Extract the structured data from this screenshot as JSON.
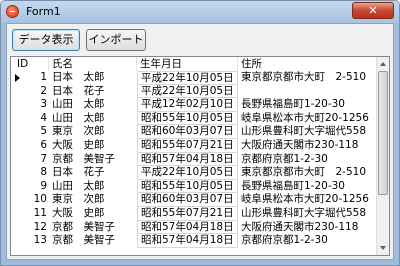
{
  "window": {
    "title": "Form1",
    "close_label": "✕"
  },
  "toolbar": {
    "show_data_label": "データ表示",
    "import_label": "インポート"
  },
  "grid": {
    "columns": [
      "ID",
      "氏名",
      "生年月日",
      "住所"
    ],
    "rows": [
      {
        "id": "1",
        "name": "日本　太郎",
        "dob": "平成22年10月05日",
        "address": "東京都京都市大町　2-510"
      },
      {
        "id": "2",
        "name": "日本　花子",
        "dob": "平成22年10月05日",
        "address": ""
      },
      {
        "id": "3",
        "name": "山田　太郎",
        "dob": "平成12年02月10日",
        "address": "長野県福島町1-20-30"
      },
      {
        "id": "4",
        "name": "山田　太郎",
        "dob": "昭和55年10月05日",
        "address": "岐阜県松本市大町20-1256"
      },
      {
        "id": "5",
        "name": "東京　次郎",
        "dob": "昭和60年03月07日",
        "address": "山形県豊科町大字堀代558"
      },
      {
        "id": "6",
        "name": "大阪　史郎",
        "dob": "昭和55年07月21日",
        "address": "大阪府通天閣市230-118"
      },
      {
        "id": "7",
        "name": "京都　美智子",
        "dob": "昭和57年04月18日",
        "address": "京都府京都1-2-30"
      },
      {
        "id": "8",
        "name": "日本　花子",
        "dob": "平成22年10月05日",
        "address": "東京都京都市大町　2-510"
      },
      {
        "id": "9",
        "name": "山田　太郎",
        "dob": "昭和55年10月05日",
        "address": "長野県福島町1-20-30"
      },
      {
        "id": "10",
        "name": "東京　次郎",
        "dob": "昭和60年03月07日",
        "address": "岐阜県松本市大町20-1256"
      },
      {
        "id": "11",
        "name": "大阪　史郎",
        "dob": "昭和55年07月21日",
        "address": "山形県豊科町大字堀代558"
      },
      {
        "id": "12",
        "name": "京都　美智子",
        "dob": "昭和57年04月18日",
        "address": "大阪府通天閣市230-118"
      },
      {
        "id": "13",
        "name": "京都　美智子",
        "dob": "昭和57年04月18日",
        "address": "京都府京都1-2-30"
      }
    ]
  },
  "icons": {
    "app": "app-icon",
    "row_selector": "row-selector-arrow-icon"
  },
  "colors": {
    "title_bar": "#a7c2e0",
    "close_button": "#c44a32",
    "grid_background": "#ffffff"
  }
}
